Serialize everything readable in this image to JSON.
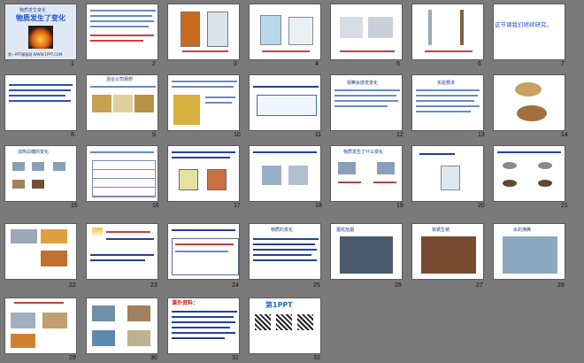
{
  "slides": [
    {
      "n": "1",
      "title": "物质发生了变化",
      "sub": "第一PPT模板网-WWW.1PPT.COM"
    },
    {
      "n": "2"
    },
    {
      "n": "3"
    },
    {
      "n": "4"
    },
    {
      "n": "5"
    },
    {
      "n": "6"
    },
    {
      "n": "7",
      "title": "这节课我们继续研究。"
    },
    {
      "n": "8"
    },
    {
      "n": "9",
      "title": "混合公司猜想"
    },
    {
      "n": "10"
    },
    {
      "n": "11"
    },
    {
      "n": "12",
      "title": "观察会感觉变化"
    },
    {
      "n": "13",
      "title": "实验要求"
    },
    {
      "n": "14"
    },
    {
      "n": "15",
      "title": "加热白糖的变化"
    },
    {
      "n": "16"
    },
    {
      "n": "17"
    },
    {
      "n": "18"
    },
    {
      "n": "19",
      "title": "物质发生了什么变化"
    },
    {
      "n": "20"
    },
    {
      "n": "21"
    },
    {
      "n": "22"
    },
    {
      "n": "23"
    },
    {
      "n": "24"
    },
    {
      "n": "25",
      "title": "物质的变化"
    },
    {
      "n": "26",
      "title": "烟花焰烟"
    },
    {
      "n": "27",
      "title": "铁锈生锈"
    },
    {
      "n": "28",
      "title": "水的沸腾"
    },
    {
      "n": "29"
    },
    {
      "n": "30"
    },
    {
      "n": "31",
      "title": "课外资料："
    },
    {
      "n": "32",
      "title": "第1PPT"
    }
  ]
}
